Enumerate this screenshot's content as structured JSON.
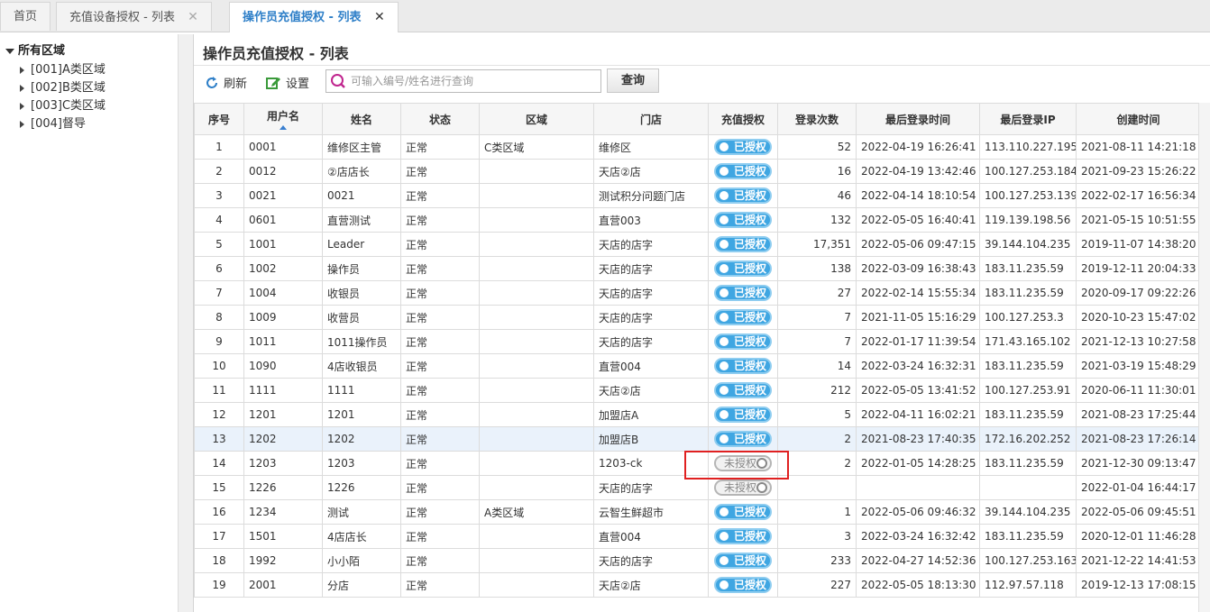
{
  "tabs": [
    {
      "label": "首页",
      "closable": false
    },
    {
      "label": "充值设备授权 - 列表",
      "closable": true
    },
    {
      "label": "操作员充值授权 - 列表",
      "closable": true,
      "active": true
    }
  ],
  "tab_close_glyph": "✕",
  "tree": {
    "root": "所有区域",
    "items": [
      "[001]A类区域",
      "[002]B类区域",
      "[003]C类区域",
      "[004]督导"
    ]
  },
  "page_title": "操作员充值授权 - 列表",
  "toolbar": {
    "refresh_label": "刷新",
    "settings_label": "设置",
    "search_placeholder": "可输入编号/姓名进行查询",
    "search_value": "",
    "query_label": "查询"
  },
  "columns": [
    "序号",
    "用户名",
    "姓名",
    "状态",
    "区域",
    "门店",
    "充值授权",
    "登录次数",
    "最后登录时间",
    "最后登录IP",
    "创建时间"
  ],
  "sort": {
    "column": "用户名",
    "direction": "asc"
  },
  "rows": [
    {
      "no": "1",
      "user": "0001",
      "name": "维修区主管",
      "status": "正常",
      "area": "C类区域",
      "store": "维修区",
      "auth": "已授权",
      "logins": "52",
      "last_time": "2022-04-19 16:26:41",
      "last_ip": "113.110.227.195",
      "created": "2021-08-11 14:21:18"
    },
    {
      "no": "2",
      "user": "0012",
      "name": "②店店长",
      "status": "正常",
      "area": "",
      "store": "天店②店",
      "auth": "已授权",
      "logins": "16",
      "last_time": "2022-04-19 13:42:46",
      "last_ip": "100.127.253.184",
      "created": "2021-09-23 15:26:22"
    },
    {
      "no": "3",
      "user": "0021",
      "name": "0021",
      "status": "正常",
      "area": "",
      "store": "测试积分问题门店",
      "auth": "已授权",
      "logins": "46",
      "last_time": "2022-04-14 18:10:54",
      "last_ip": "100.127.253.139",
      "created": "2022-02-17 16:56:34"
    },
    {
      "no": "4",
      "user": "0601",
      "name": "直营测试",
      "status": "正常",
      "area": "",
      "store": "直营003",
      "auth": "已授权",
      "logins": "132",
      "last_time": "2022-05-05 16:40:41",
      "last_ip": "119.139.198.56",
      "created": "2021-05-15 10:51:55"
    },
    {
      "no": "5",
      "user": "1001",
      "name": "Leader",
      "status": "正常",
      "area": "",
      "store": "天店的店字",
      "auth": "已授权",
      "logins": "17,351",
      "last_time": "2022-05-06 09:47:15",
      "last_ip": "39.144.104.235",
      "created": "2019-11-07 14:38:20"
    },
    {
      "no": "6",
      "user": "1002",
      "name": "操作员",
      "status": "正常",
      "area": "",
      "store": "天店的店字",
      "auth": "已授权",
      "logins": "138",
      "last_time": "2022-03-09 16:38:43",
      "last_ip": "183.11.235.59",
      "created": "2019-12-11 20:04:33"
    },
    {
      "no": "7",
      "user": "1004",
      "name": "收银员",
      "status": "正常",
      "area": "",
      "store": "天店的店字",
      "auth": "已授权",
      "logins": "27",
      "last_time": "2022-02-14 15:55:34",
      "last_ip": "183.11.235.59",
      "created": "2020-09-17 09:22:26"
    },
    {
      "no": "8",
      "user": "1009",
      "name": "收营员",
      "status": "正常",
      "area": "",
      "store": "天店的店字",
      "auth": "已授权",
      "logins": "7",
      "last_time": "2021-11-05 15:16:29",
      "last_ip": "100.127.253.3",
      "created": "2020-10-23 15:47:02"
    },
    {
      "no": "9",
      "user": "1011",
      "name": "1011操作员",
      "status": "正常",
      "area": "",
      "store": "天店的店字",
      "auth": "已授权",
      "logins": "7",
      "last_time": "2022-01-17 11:39:54",
      "last_ip": "171.43.165.102",
      "created": "2021-12-13 10:27:58"
    },
    {
      "no": "10",
      "user": "1090",
      "name": "4店收银员",
      "status": "正常",
      "area": "",
      "store": "直营004",
      "auth": "已授权",
      "logins": "14",
      "last_time": "2022-03-24 16:32:31",
      "last_ip": "183.11.235.59",
      "created": "2021-03-19 15:48:29"
    },
    {
      "no": "11",
      "user": "1111",
      "name": "1111",
      "status": "正常",
      "area": "",
      "store": "天店②店",
      "auth": "已授权",
      "logins": "212",
      "last_time": "2022-05-05 13:41:52",
      "last_ip": "100.127.253.91",
      "created": "2020-06-11 11:30:01"
    },
    {
      "no": "12",
      "user": "1201",
      "name": "1201",
      "status": "正常",
      "area": "",
      "store": "加盟店A",
      "auth": "已授权",
      "logins": "5",
      "last_time": "2022-04-11 16:02:21",
      "last_ip": "183.11.235.59",
      "created": "2021-08-23 17:25:44"
    },
    {
      "no": "13",
      "user": "1202",
      "name": "1202",
      "status": "正常",
      "area": "",
      "store": "加盟店B",
      "auth": "已授权",
      "logins": "2",
      "last_time": "2021-08-23 17:40:35",
      "last_ip": "172.16.202.252",
      "created": "2021-08-23 17:26:14",
      "highlight": true
    },
    {
      "no": "14",
      "user": "1203",
      "name": "1203",
      "status": "正常",
      "area": "",
      "store": "1203-ck",
      "auth": "未授权",
      "logins": "2",
      "last_time": "2022-01-05 14:28:25",
      "last_ip": "183.11.235.59",
      "created": "2021-12-30 09:13:47"
    },
    {
      "no": "15",
      "user": "1226",
      "name": "1226",
      "status": "正常",
      "area": "",
      "store": "天店的店字",
      "auth": "未授权",
      "logins": "",
      "last_time": "",
      "last_ip": "",
      "created": "2022-01-04 16:44:17"
    },
    {
      "no": "16",
      "user": "1234",
      "name": "测试",
      "status": "正常",
      "area": "A类区域",
      "store": "云智生鲜超市",
      "auth": "已授权",
      "logins": "1",
      "last_time": "2022-05-06 09:46:32",
      "last_ip": "39.144.104.235",
      "created": "2022-05-06 09:45:51"
    },
    {
      "no": "17",
      "user": "1501",
      "name": "4店店长",
      "status": "正常",
      "area": "",
      "store": "直营004",
      "auth": "已授权",
      "logins": "3",
      "last_time": "2022-03-24 16:32:42",
      "last_ip": "183.11.235.59",
      "created": "2020-12-01 11:46:28"
    },
    {
      "no": "18",
      "user": "1992",
      "name": "小小陌",
      "status": "正常",
      "area": "",
      "store": "天店的店字",
      "auth": "已授权",
      "logins": "233",
      "last_time": "2022-04-27 14:52:36",
      "last_ip": "100.127.253.163",
      "created": "2021-12-22 14:41:53"
    },
    {
      "no": "19",
      "user": "2001",
      "name": "分店",
      "status": "正常",
      "area": "",
      "store": "天店②店",
      "auth": "已授权",
      "logins": "227",
      "last_time": "2022-05-05 18:13:30",
      "last_ip": "112.97.57.118",
      "created": "2019-12-13 17:08:15"
    }
  ],
  "colors": {
    "accent": "#2e7fc8",
    "switch_on": "#3fa6e2",
    "switch_off": "#f2f2f2",
    "highlight_box": "#e02020",
    "highlight_row": "#eaf2fb"
  }
}
